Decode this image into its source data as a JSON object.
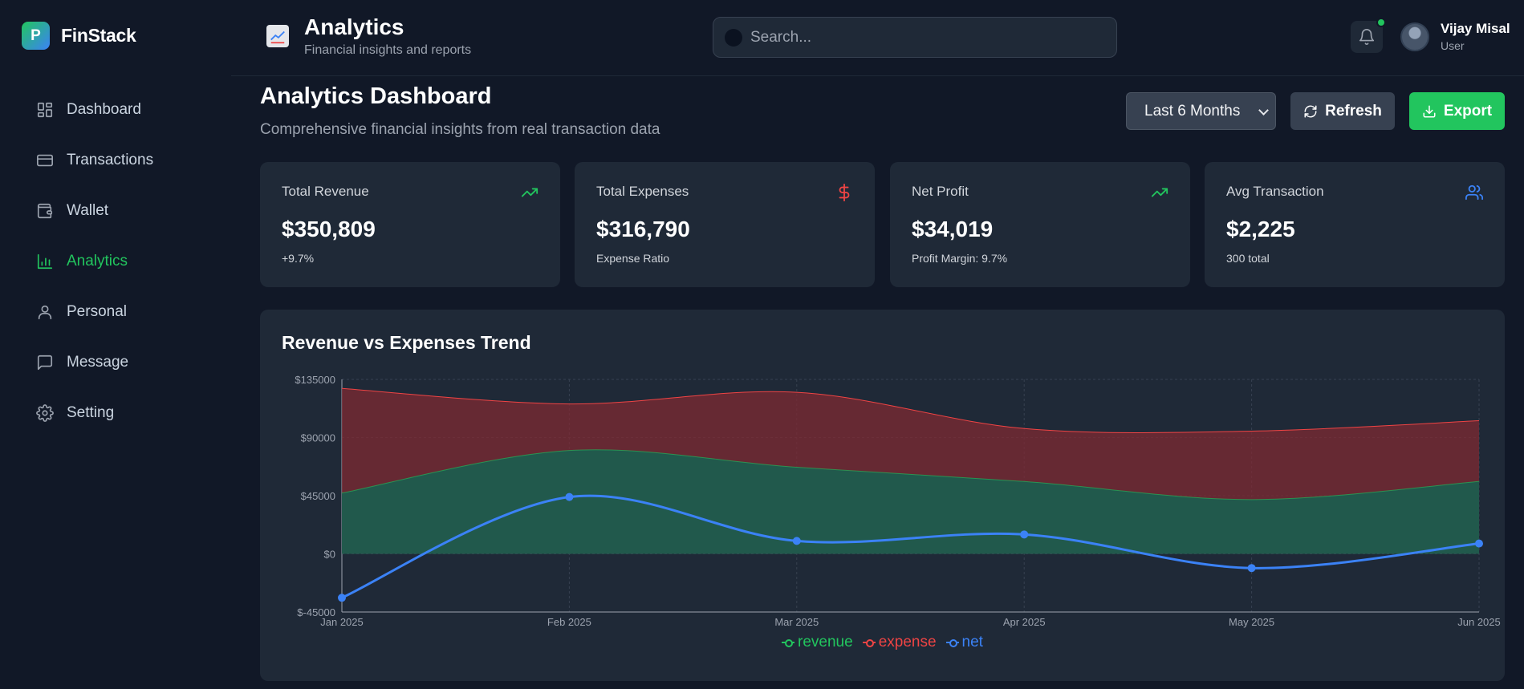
{
  "brand": {
    "logo_letter": "P",
    "name": "FinStack"
  },
  "sidebar": {
    "items": [
      {
        "label": "Dashboard",
        "icon": "dashboard-icon",
        "active": false
      },
      {
        "label": "Transactions",
        "icon": "card-icon",
        "active": false
      },
      {
        "label": "Wallet",
        "icon": "wallet-icon",
        "active": false
      },
      {
        "label": "Analytics",
        "icon": "bar-chart-icon",
        "active": true
      },
      {
        "label": "Personal",
        "icon": "user-icon",
        "active": false
      },
      {
        "label": "Message",
        "icon": "message-icon",
        "active": false
      },
      {
        "label": "Setting",
        "icon": "gear-icon",
        "active": false
      }
    ]
  },
  "header": {
    "title": "Analytics",
    "subtitle": "Financial insights and reports",
    "search_placeholder": "Search...",
    "user_name": "Vijay Misal",
    "user_role": "User"
  },
  "page": {
    "title": "Analytics Dashboard",
    "subtitle": "Comprehensive financial insights from real transaction data",
    "period": "Last 6 Months",
    "refresh_label": "Refresh",
    "export_label": "Export"
  },
  "stats": [
    {
      "label": "Total Revenue",
      "value": "$350,809",
      "note": "+9.7%",
      "icon": "trending-up-icon",
      "color": "#22c55e"
    },
    {
      "label": "Total Expenses",
      "value": "$316,790",
      "note": "Expense Ratio",
      "icon": "dollar-icon",
      "color": "#ef4444"
    },
    {
      "label": "Net Profit",
      "value": "$34,019",
      "note": "Profit Margin: 9.7%",
      "icon": "trending-up-icon",
      "color": "#22c55e"
    },
    {
      "label": "Avg Transaction",
      "value": "$2,225",
      "note": "300 total",
      "icon": "users-icon",
      "color": "#3b82f6"
    }
  ],
  "chart_title": "Revenue vs Expenses Trend",
  "chart_data": {
    "type": "area",
    "categories": [
      "Jan 2025",
      "Feb 2025",
      "Mar 2025",
      "Apr 2025",
      "May 2025",
      "Jun 2025"
    ],
    "series": [
      {
        "name": "revenue",
        "values": [
          47000,
          80000,
          67000,
          56000,
          42000,
          56000
        ],
        "color": "#22c55e"
      },
      {
        "name": "expense",
        "values": [
          128000,
          116000,
          125000,
          97000,
          95000,
          103000
        ],
        "color": "#ef4444"
      },
      {
        "name": "net",
        "values": [
          -34000,
          44000,
          10000,
          15000,
          -11000,
          8000
        ],
        "color": "#3b82f6"
      }
    ],
    "ylim": [
      -45000,
      135000
    ],
    "yticks": [
      "$135000",
      "$90000",
      "$45000",
      "$0",
      "$-45000"
    ],
    "grid": true,
    "legend": "bottom"
  }
}
